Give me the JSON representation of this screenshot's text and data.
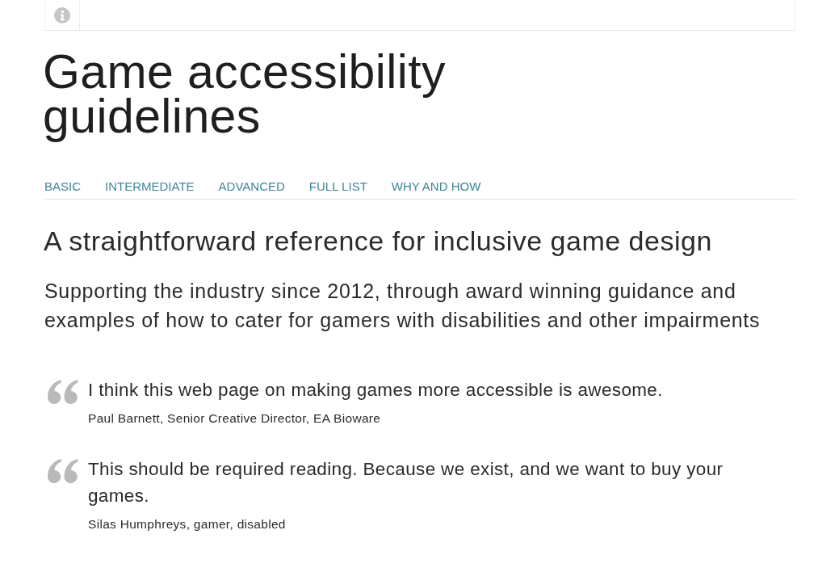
{
  "title": "Game accessibility guidelines",
  "nav": [
    {
      "label": "BASIC"
    },
    {
      "label": "INTERMEDIATE"
    },
    {
      "label": "ADVANCED"
    },
    {
      "label": "FULL LIST"
    },
    {
      "label": "WHY AND HOW"
    }
  ],
  "tagline": "A straightforward reference for inclusive game design",
  "intro": "Supporting the industry since 2012, through award winning guidance and examples of how to cater for gamers with disabilities and other impairments",
  "quotes": [
    {
      "text": "I think this web page on making games more accessible is awesome.",
      "attribution": "Paul Barnett, Senior Creative Director, EA Bioware"
    },
    {
      "text": "This should be required reading. Because we exist, and we want to buy your games.",
      "attribution": "Silas Humphreys, gamer, disabled"
    }
  ]
}
